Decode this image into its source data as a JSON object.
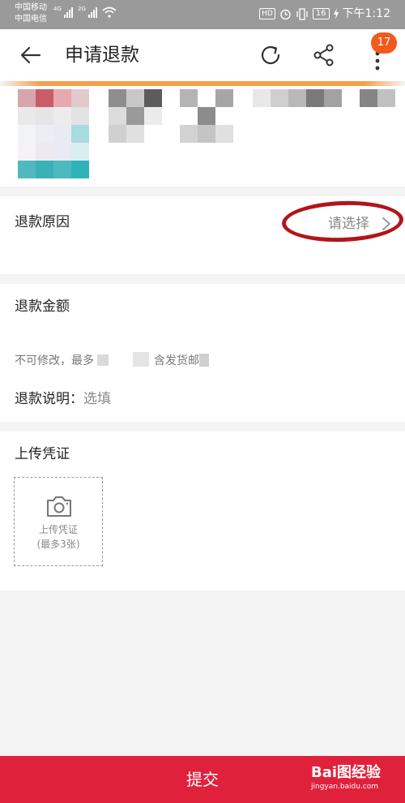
{
  "status_bar": {
    "carrier_1": "中国移动",
    "carrier_2": "中国电信",
    "net_1": "4G",
    "net_2": "2G",
    "hd": "HD",
    "battery": "16",
    "time": "下午1:12"
  },
  "header": {
    "title": "申请退款",
    "badge_count": "17"
  },
  "refund_reason": {
    "label": "退款原因",
    "value": "请选择"
  },
  "refund_amount": {
    "label": "退款金额",
    "hint_prefix": "不可修改，最多",
    "hint_middle": "含发货邮",
    "description_label": "退款说明：",
    "description_placeholder": "选填"
  },
  "upload": {
    "title": "上传凭证",
    "box_line1": "上传凭证",
    "box_line2": "(最多3张)"
  },
  "submit_label": "提交",
  "watermark": {
    "main": "Bai图经验",
    "sub": "jingyan.baidu.com"
  },
  "colors": {
    "accent_red": "#e0213b",
    "badge_orange": "#f25a1c",
    "annotation_red": "#b3141a"
  },
  "icons": [
    "back-arrow-icon",
    "refresh-icon",
    "share-icon",
    "more-icon",
    "chevron-right-icon",
    "camera-icon",
    "wifi-icon",
    "alarm-icon",
    "vibrate-icon",
    "charging-icon"
  ]
}
